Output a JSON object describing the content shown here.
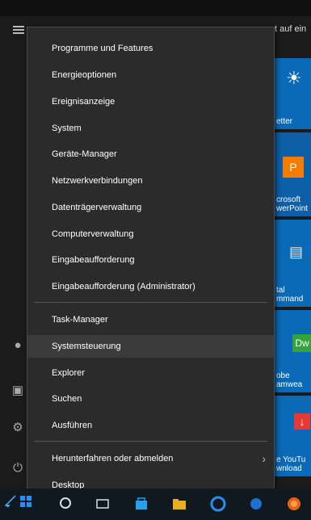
{
  "background": {
    "header_fragment": "t auf ein",
    "tiles": [
      {
        "label": "etter",
        "icon": "sun-icon"
      },
      {
        "label": "crosoft\nwerPoint",
        "icon": "powerpoint-icon"
      },
      {
        "label": "tal\nmmand",
        "icon": "app-icon"
      },
      {
        "label": "obe\namwea",
        "icon": "dreamweaver-icon",
        "badge": "Dw"
      },
      {
        "label": "e YouTu\nwnload",
        "icon": "download-icon"
      }
    ]
  },
  "menu": {
    "items": [
      {
        "label": "Programme und Features"
      },
      {
        "label": "Energieoptionen"
      },
      {
        "label": "Ereignisanzeige"
      },
      {
        "label": "System"
      },
      {
        "label": "Geräte-Manager"
      },
      {
        "label": "Netzwerkverbindungen"
      },
      {
        "label": "Datenträgerverwaltung"
      },
      {
        "label": "Computerverwaltung"
      },
      {
        "label": "Eingabeaufforderung"
      },
      {
        "label": "Eingabeaufforderung (Administrator)"
      },
      {
        "label": "Task-Manager"
      },
      {
        "label": "Systemsteuerung",
        "highlighted": true
      },
      {
        "label": "Explorer"
      },
      {
        "label": "Suchen"
      },
      {
        "label": "Ausführen"
      },
      {
        "label": "Herunterfahren oder abmelden",
        "submenu": true
      },
      {
        "label": "Desktop"
      }
    ]
  },
  "colors": {
    "menu_bg": "#2b2b2b",
    "highlight": "#3b3b3b",
    "tile_blue": "#0a6ab8",
    "windows_blue": "#1e90ff"
  }
}
